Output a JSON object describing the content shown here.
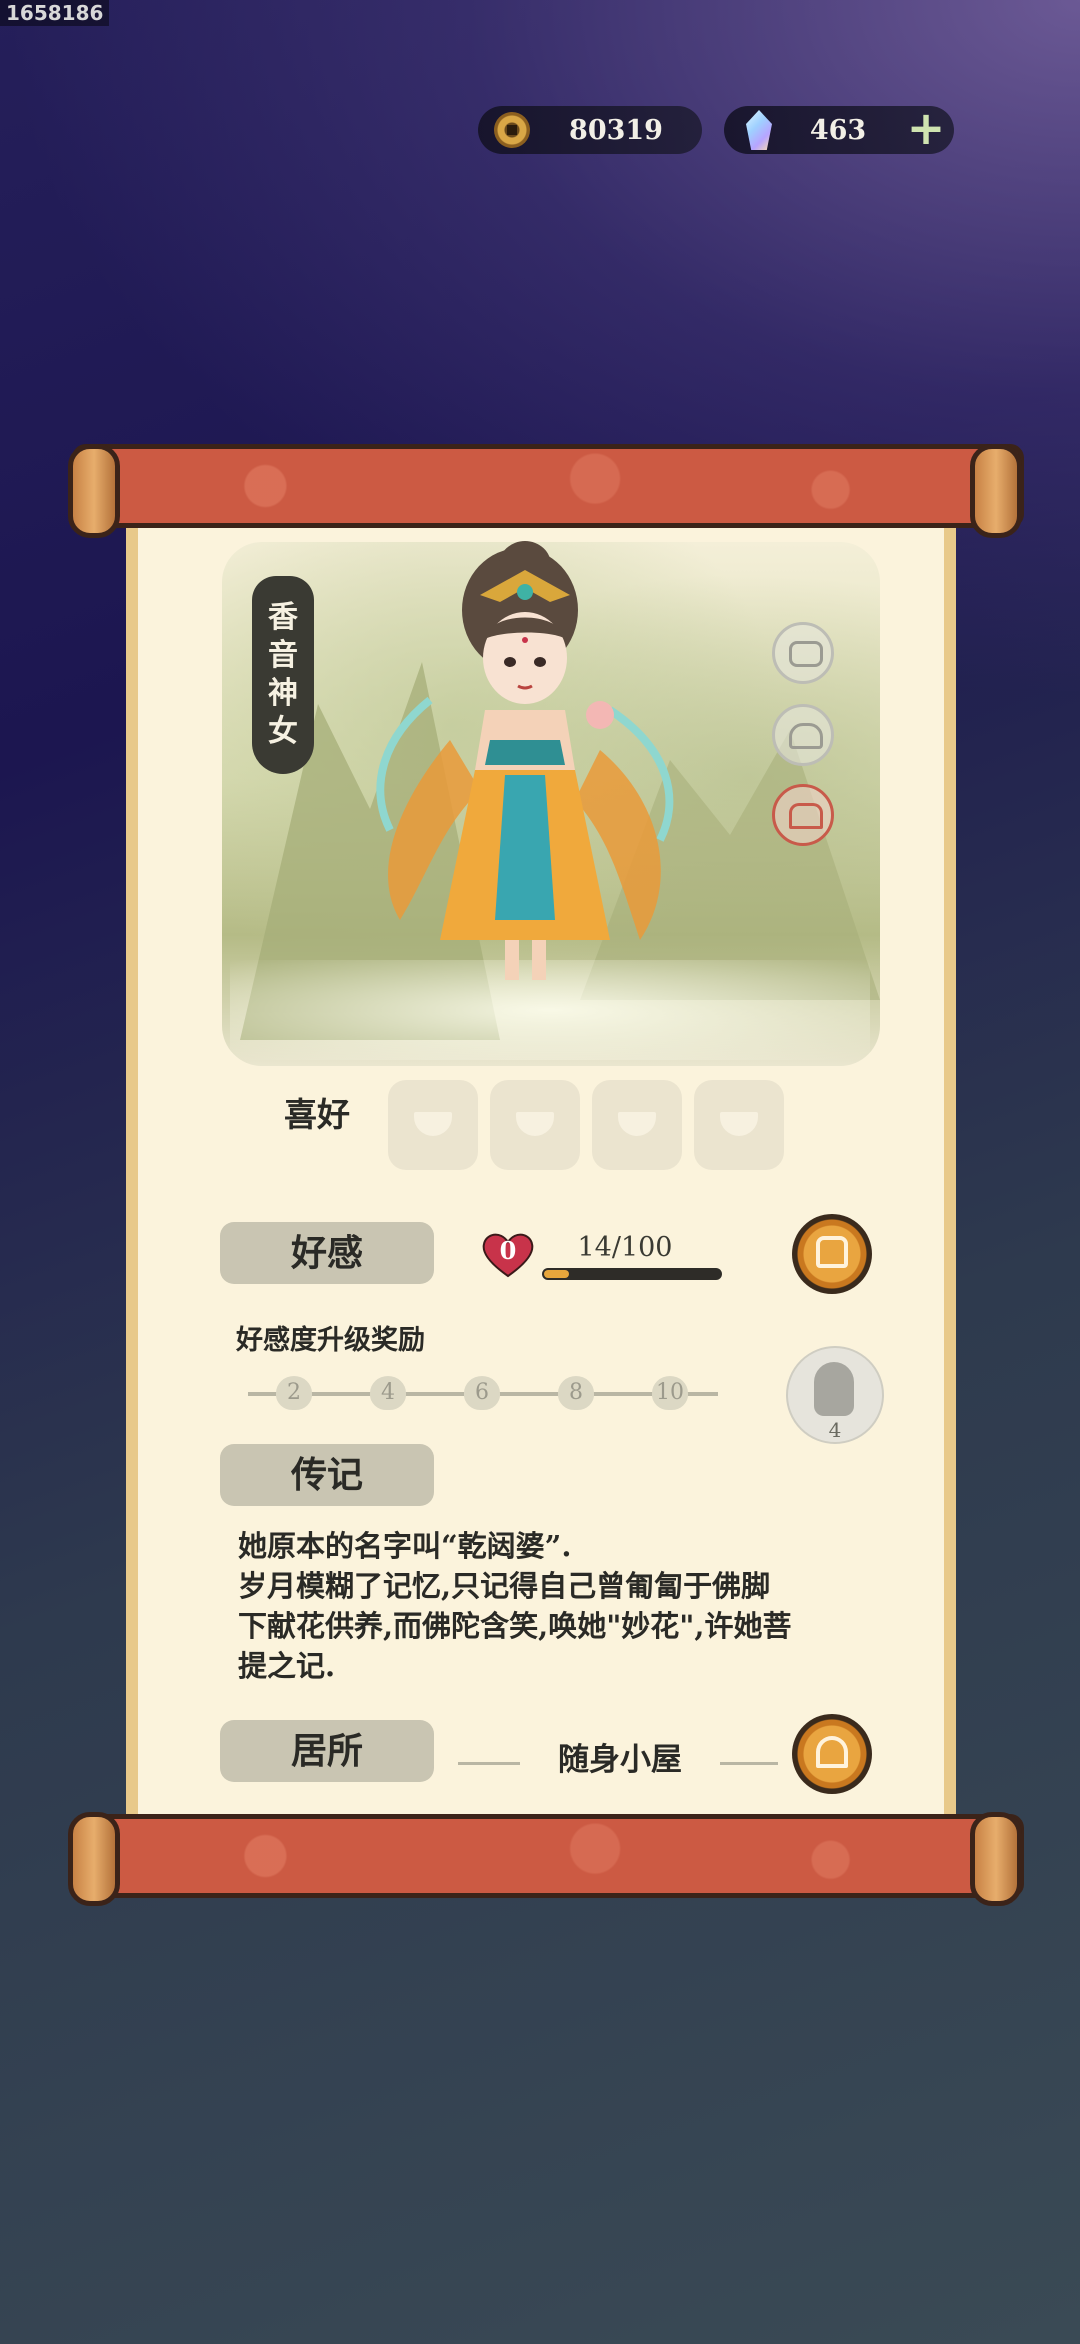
{
  "build_id": "1658186",
  "currency": {
    "coins": "80319",
    "gems": "463",
    "add_label": "+"
  },
  "character": {
    "name_chars": [
      "香",
      "音",
      "神",
      "女"
    ]
  },
  "hobbies": {
    "label": "喜好",
    "slots": 4
  },
  "favor": {
    "label": "好感",
    "level": "0",
    "progress_text": "14/100",
    "progress": 0.14,
    "reward_title": "好感度升级奖励",
    "milestones": [
      "2",
      "4",
      "6",
      "8",
      "10"
    ],
    "reward_count": "4"
  },
  "bio": {
    "label": "传记",
    "lines": [
      "她原本的名字叫“乾闼婆”.",
      "岁月模糊了记忆,只记得自己曾匍匐于佛脚",
      "下献花供养,而佛陀含笑,唤她\"妙花\",许她菩",
      "提之记."
    ]
  },
  "residence": {
    "label": "居所",
    "name": "随身小屋"
  },
  "colors": {
    "scroll_rod": "#cc5a43",
    "paper": "#fbf3dc",
    "accent_orange": "#e9a540",
    "heart_red": "#c8334a"
  }
}
